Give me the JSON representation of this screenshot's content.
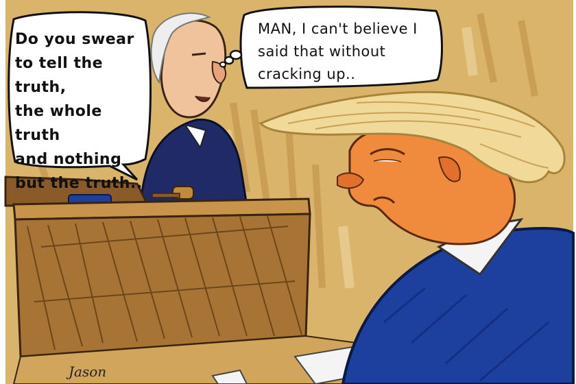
{
  "speech_bubble": {
    "text": "Do you swear\nto tell the truth,\nthe whole truth\nand nothing\nbut the truth.."
  },
  "thought_bubble": {
    "text": "MAN, I can't believe I\nsaid that without\ncracking up.."
  },
  "signature": {
    "text": "Jason"
  },
  "colors": {
    "wall": "#d9b46a",
    "wall_shadow": "#b9853c",
    "bench_wood": "#a87436",
    "bench_dark": "#6b431b",
    "robe": "#1f2a66",
    "jacket": "#1d3f9e",
    "skin_judge": "#f0c39c",
    "skin_orange": "#f08a3c",
    "hair": "#f1d99a"
  },
  "icons": {
    "gavel": "gavel-icon"
  }
}
